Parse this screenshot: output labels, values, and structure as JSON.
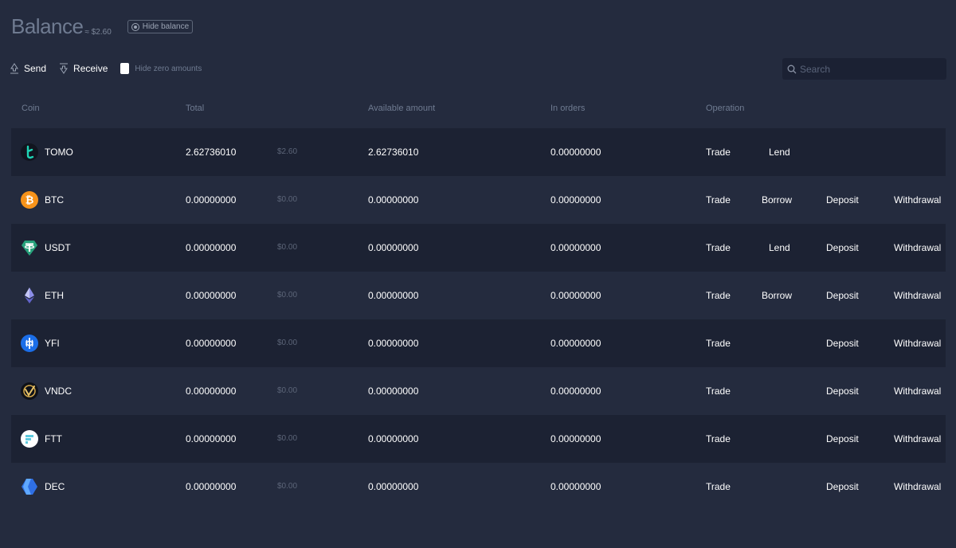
{
  "header": {
    "title": "Balance",
    "approx": "≈ $2.60",
    "hide_balance_label": "Hide balance"
  },
  "toolbar": {
    "send_label": "Send",
    "receive_label": "Receive",
    "hide_zero_label": "Hide zero amounts"
  },
  "search": {
    "placeholder": "Search",
    "value": ""
  },
  "columns": {
    "coin": "Coin",
    "total": "Total",
    "available": "Available amount",
    "in_orders": "In orders",
    "operation": "Operation"
  },
  "rows": [
    {
      "coin": "TOMO",
      "icon": "tomo-icon",
      "total": "2.62736010",
      "usd": "$2.60",
      "available": "2.62736010",
      "in_orders": "0.00000000",
      "ops": [
        "Trade",
        "Lend",
        "",
        ""
      ]
    },
    {
      "coin": "BTC",
      "icon": "btc-icon",
      "total": "0.00000000",
      "usd": "$0.00",
      "available": "0.00000000",
      "in_orders": "0.00000000",
      "ops": [
        "Trade",
        "Borrow",
        "Deposit",
        "Withdrawal"
      ]
    },
    {
      "coin": "USDT",
      "icon": "usdt-icon",
      "total": "0.00000000",
      "usd": "$0.00",
      "available": "0.00000000",
      "in_orders": "0.00000000",
      "ops": [
        "Trade",
        "Lend",
        "Deposit",
        "Withdrawal"
      ]
    },
    {
      "coin": "ETH",
      "icon": "eth-icon",
      "total": "0.00000000",
      "usd": "$0.00",
      "available": "0.00000000",
      "in_orders": "0.00000000",
      "ops": [
        "Trade",
        "Borrow",
        "Deposit",
        "Withdrawal"
      ]
    },
    {
      "coin": "YFI",
      "icon": "yfi-icon",
      "total": "0.00000000",
      "usd": "$0.00",
      "available": "0.00000000",
      "in_orders": "0.00000000",
      "ops": [
        "Trade",
        "",
        "Deposit",
        "Withdrawal"
      ]
    },
    {
      "coin": "VNDC",
      "icon": "vndc-icon",
      "total": "0.00000000",
      "usd": "$0.00",
      "available": "0.00000000",
      "in_orders": "0.00000000",
      "ops": [
        "Trade",
        "",
        "Deposit",
        "Withdrawal"
      ]
    },
    {
      "coin": "FTT",
      "icon": "ftt-icon",
      "total": "0.00000000",
      "usd": "$0.00",
      "available": "0.00000000",
      "in_orders": "0.00000000",
      "ops": [
        "Trade",
        "",
        "Deposit",
        "Withdrawal"
      ]
    },
    {
      "coin": "DEC",
      "icon": "dec-icon",
      "total": "0.00000000",
      "usd": "$0.00",
      "available": "0.00000000",
      "in_orders": "0.00000000",
      "ops": [
        "Trade",
        "",
        "Deposit",
        "Withdrawal"
      ]
    }
  ],
  "colors": {
    "background": "#242b3e",
    "row_dark": "#1c2233",
    "muted_text": "#6f7b91",
    "btc": "#f7931a",
    "usdt": "#26a17b",
    "yfi": "#1b6ee8"
  }
}
